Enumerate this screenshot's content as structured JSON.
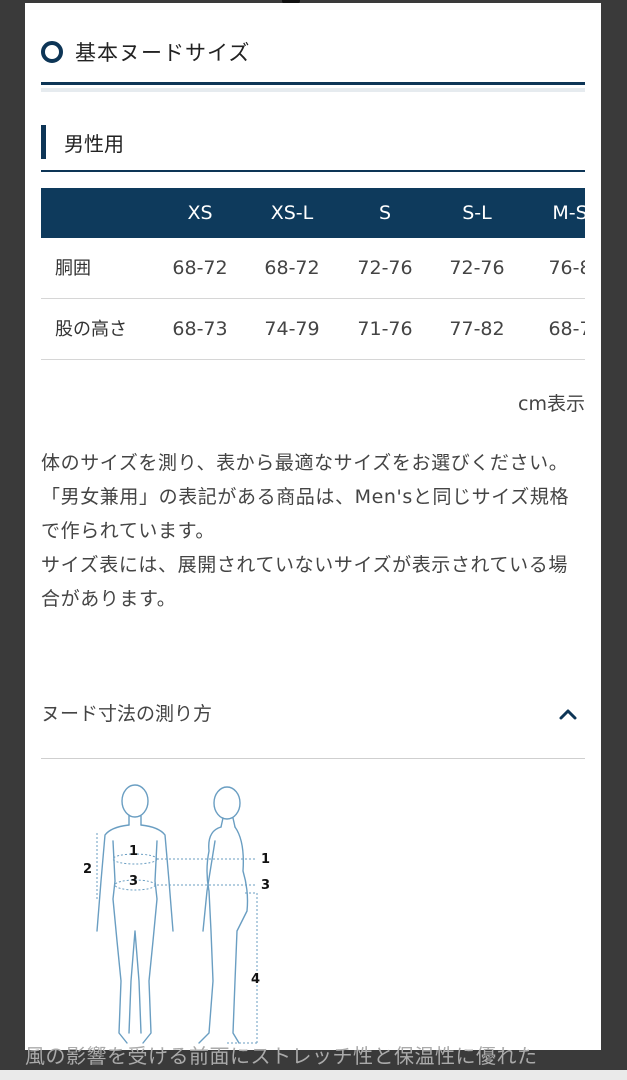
{
  "section": {
    "title": "基本ヌードサイズ",
    "icon": "ring-icon"
  },
  "subsection": {
    "title": "男性用"
  },
  "table": {
    "headers": [
      "XS",
      "XS-L",
      "S",
      "S-L",
      "M-S"
    ],
    "rows": [
      {
        "label": "胴囲",
        "values": [
          "68-72",
          "68-72",
          "72-76",
          "72-76",
          "76-8"
        ]
      },
      {
        "label": "股の高さ",
        "values": [
          "68-73",
          "74-79",
          "71-76",
          "77-82",
          "68-7"
        ]
      }
    ]
  },
  "unit_note": "cm表示",
  "description": [
    "体のサイズを測り、表から最適なサイズをお選びください。",
    "「男女兼用」の表記がある商品は、Men'sと同じサイズ規格で作られています。",
    "サイズ表には、展開されていないサイズが表示されている場合があります。"
  ],
  "accordion": {
    "label": "ヌード寸法の測り方",
    "icon": "chevron-up-icon"
  },
  "figure_labels": {
    "front": [
      "1",
      "2",
      "3"
    ],
    "side": [
      "1",
      "3",
      "4"
    ]
  },
  "footer_bleed_text": "風の影響を受ける前面にストレッチ性と保温性に優れた",
  "colors": {
    "navy": "#0e3a5c",
    "figure_line": "#6a9ec2"
  }
}
